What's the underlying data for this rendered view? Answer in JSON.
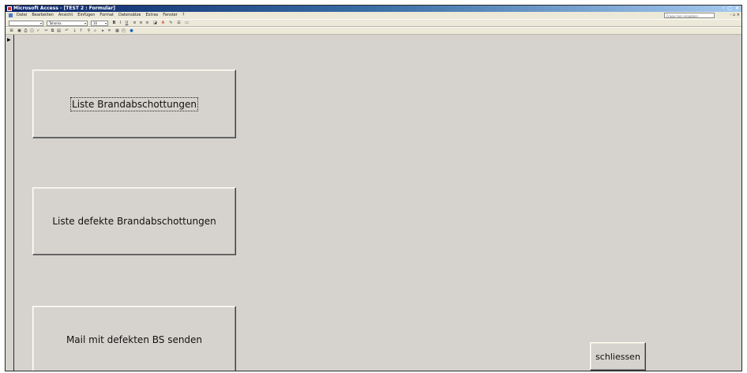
{
  "window": {
    "title": "Microsoft Access - [TEST 2 : Formular]",
    "controls": "- □ ×"
  },
  "menubar": {
    "items": [
      "Datei",
      "Bearbeiten",
      "Ansicht",
      "Einfügen",
      "Format",
      "Datensätze",
      "Extras",
      "Fenster",
      "?"
    ],
    "help_placeholder": "Frage hier eingeben",
    "doc_controls": "- ▫ ×"
  },
  "toolbar_format": {
    "object_combo": "",
    "font_name": "Tahoma",
    "font_size": "16"
  },
  "form": {
    "record_selector_icon": "play-arrow-icon",
    "buttons": {
      "liste": "Liste Brandabschottungen",
      "defekte": "Liste defekte Brandabschottungen",
      "mail": "Mail mit defekten BS senden",
      "close": "schliessen"
    }
  },
  "colors": {
    "form_bg": "#d6d3ce",
    "toolbar_bg": "#ece9d8",
    "titlebar": "#0a246a"
  }
}
